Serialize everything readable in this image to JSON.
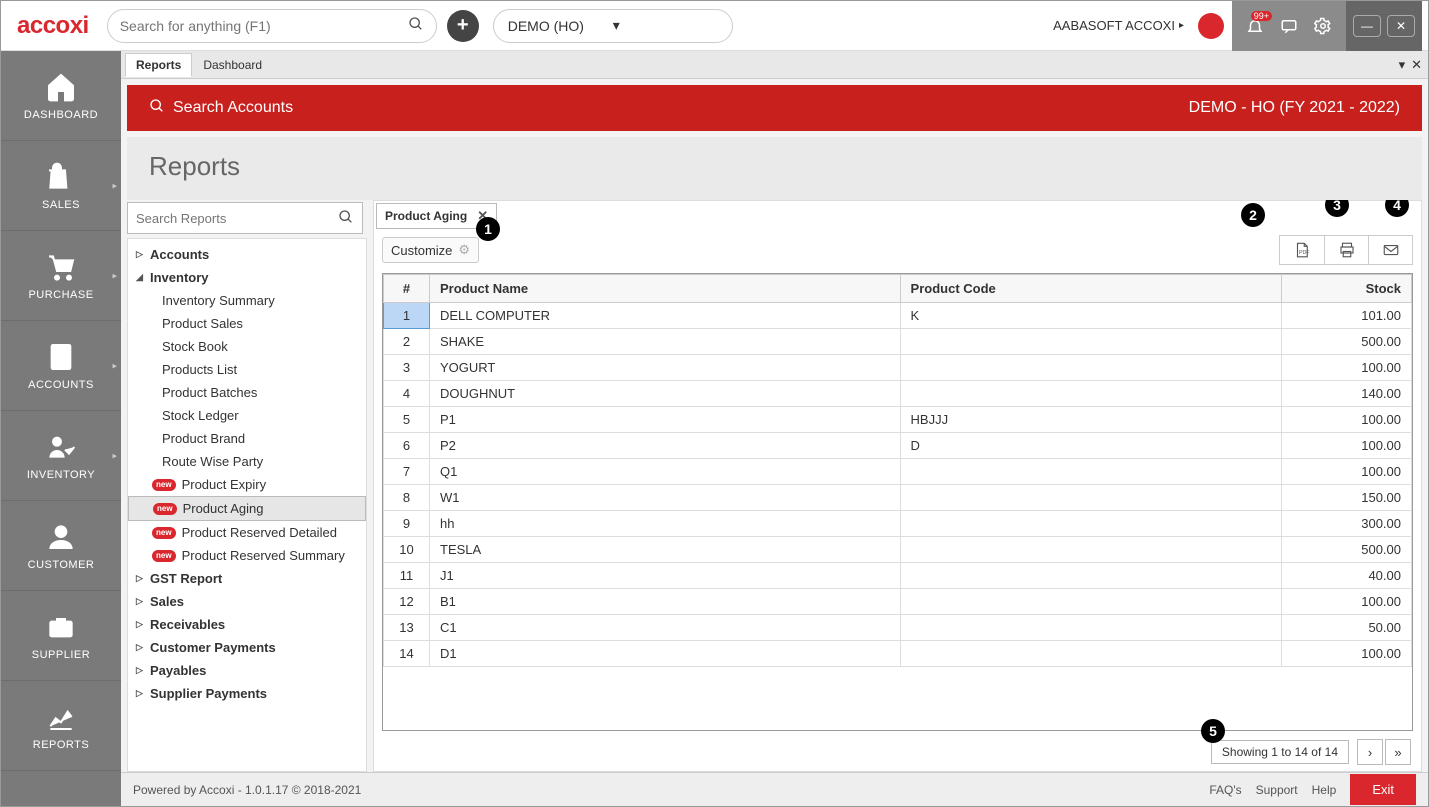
{
  "brand": "accoxi",
  "search": {
    "placeholder": "Search for anything (F1)"
  },
  "company": {
    "selected": "DEMO (HO)"
  },
  "user": {
    "name": "AABASOFT ACCOXI"
  },
  "notif_badge": "99+",
  "tabs": {
    "reports": "Reports",
    "dashboard": "Dashboard"
  },
  "banner": {
    "left": "Search Accounts",
    "right": "DEMO - HO (FY 2021 - 2022)"
  },
  "page_title": "Reports",
  "reports_search_placeholder": "Search Reports",
  "leftnav": [
    {
      "label": "DASHBOARD"
    },
    {
      "label": "SALES"
    },
    {
      "label": "PURCHASE"
    },
    {
      "label": "ACCOUNTS"
    },
    {
      "label": "INVENTORY"
    },
    {
      "label": "CUSTOMER"
    },
    {
      "label": "SUPPLIER"
    },
    {
      "label": "REPORTS"
    }
  ],
  "tree": {
    "groups": [
      {
        "label": "Accounts",
        "expanded": false
      },
      {
        "label": "Inventory",
        "expanded": true,
        "children": [
          {
            "label": "Inventory Summary"
          },
          {
            "label": "Product Sales"
          },
          {
            "label": "Stock Book"
          },
          {
            "label": "Products List"
          },
          {
            "label": "Product Batches"
          },
          {
            "label": "Stock Ledger"
          },
          {
            "label": "Product Brand"
          },
          {
            "label": "Route Wise Party"
          },
          {
            "label": "Product Expiry",
            "new": true
          },
          {
            "label": "Product Aging",
            "new": true,
            "selected": true
          },
          {
            "label": "Product Reserved Detailed",
            "new": true
          },
          {
            "label": "Product Reserved Summary",
            "new": true
          }
        ]
      },
      {
        "label": "GST Report",
        "expanded": false
      },
      {
        "label": "Sales",
        "expanded": false
      },
      {
        "label": "Receivables",
        "expanded": false
      },
      {
        "label": "Customer Payments",
        "expanded": false
      },
      {
        "label": "Payables",
        "expanded": false
      },
      {
        "label": "Supplier Payments",
        "expanded": false
      }
    ]
  },
  "report_tab": {
    "title": "Product Aging"
  },
  "customize_label": "Customize",
  "columns": {
    "idx": "#",
    "name": "Product Name",
    "code": "Product Code",
    "stock": "Stock"
  },
  "rows": [
    {
      "idx": 1,
      "name": "DELL COMPUTER",
      "code": "K",
      "stock": "101.00"
    },
    {
      "idx": 2,
      "name": "SHAKE",
      "code": "",
      "stock": "500.00"
    },
    {
      "idx": 3,
      "name": "YOGURT",
      "code": "",
      "stock": "100.00"
    },
    {
      "idx": 4,
      "name": "DOUGHNUT",
      "code": "",
      "stock": "140.00"
    },
    {
      "idx": 5,
      "name": "P1",
      "code": "HBJJJ",
      "stock": "100.00"
    },
    {
      "idx": 6,
      "name": "P2",
      "code": "D",
      "stock": "100.00"
    },
    {
      "idx": 7,
      "name": "Q1",
      "code": "",
      "stock": "100.00"
    },
    {
      "idx": 8,
      "name": "W1",
      "code": "",
      "stock": "150.00"
    },
    {
      "idx": 9,
      "name": "hh",
      "code": "",
      "stock": "300.00"
    },
    {
      "idx": 10,
      "name": "TESLA",
      "code": "",
      "stock": "500.00"
    },
    {
      "idx": 11,
      "name": "J1",
      "code": "",
      "stock": "40.00"
    },
    {
      "idx": 12,
      "name": "B1",
      "code": "",
      "stock": "100.00"
    },
    {
      "idx": 13,
      "name": "C1",
      "code": "",
      "stock": "50.00"
    },
    {
      "idx": 14,
      "name": "D1",
      "code": "",
      "stock": "100.00"
    }
  ],
  "pager": {
    "text": "Showing 1 to 14 of 14"
  },
  "footer": {
    "powered": "Powered by Accoxi - 1.0.1.17 © 2018-2021",
    "faqs": "FAQ's",
    "support": "Support",
    "help": "Help",
    "exit": "Exit"
  },
  "callouts": {
    "c1": "1",
    "c2": "2",
    "c3": "3",
    "c4": "4",
    "c5": "5"
  }
}
